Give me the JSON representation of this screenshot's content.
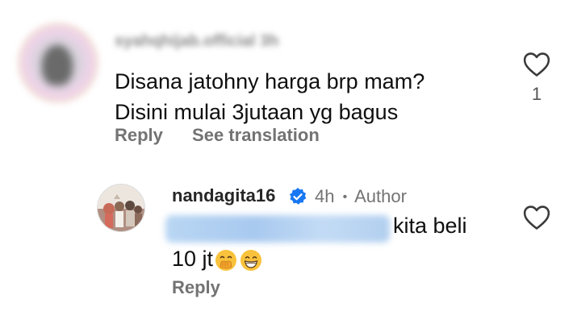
{
  "comment": {
    "username": "syahqhijab.official 3h",
    "line1": "Disana jatohny harga brp mam?",
    "line2": "Disini mulai 3jutaan yg bagus",
    "reply_label": "Reply",
    "translate_label": "See translation",
    "like_count": "1",
    "heart_icon": "heart-outline-icon"
  },
  "reply": {
    "username": "nandagita16",
    "verified_icon": "verified-badge-icon",
    "time": "4h",
    "separator": "•",
    "role": "Author",
    "mention": "@syahqhijab.official",
    "text_after_mention": "kita beli",
    "text_line2": "10 jt",
    "emojis": [
      "hand-over-mouth-emoji",
      "grinning-face-emoji"
    ],
    "reply_label": "Reply",
    "heart_icon": "heart-outline-icon",
    "colors": {
      "verified": "#1877f2",
      "mention_blur": "#a8c9ef"
    }
  }
}
